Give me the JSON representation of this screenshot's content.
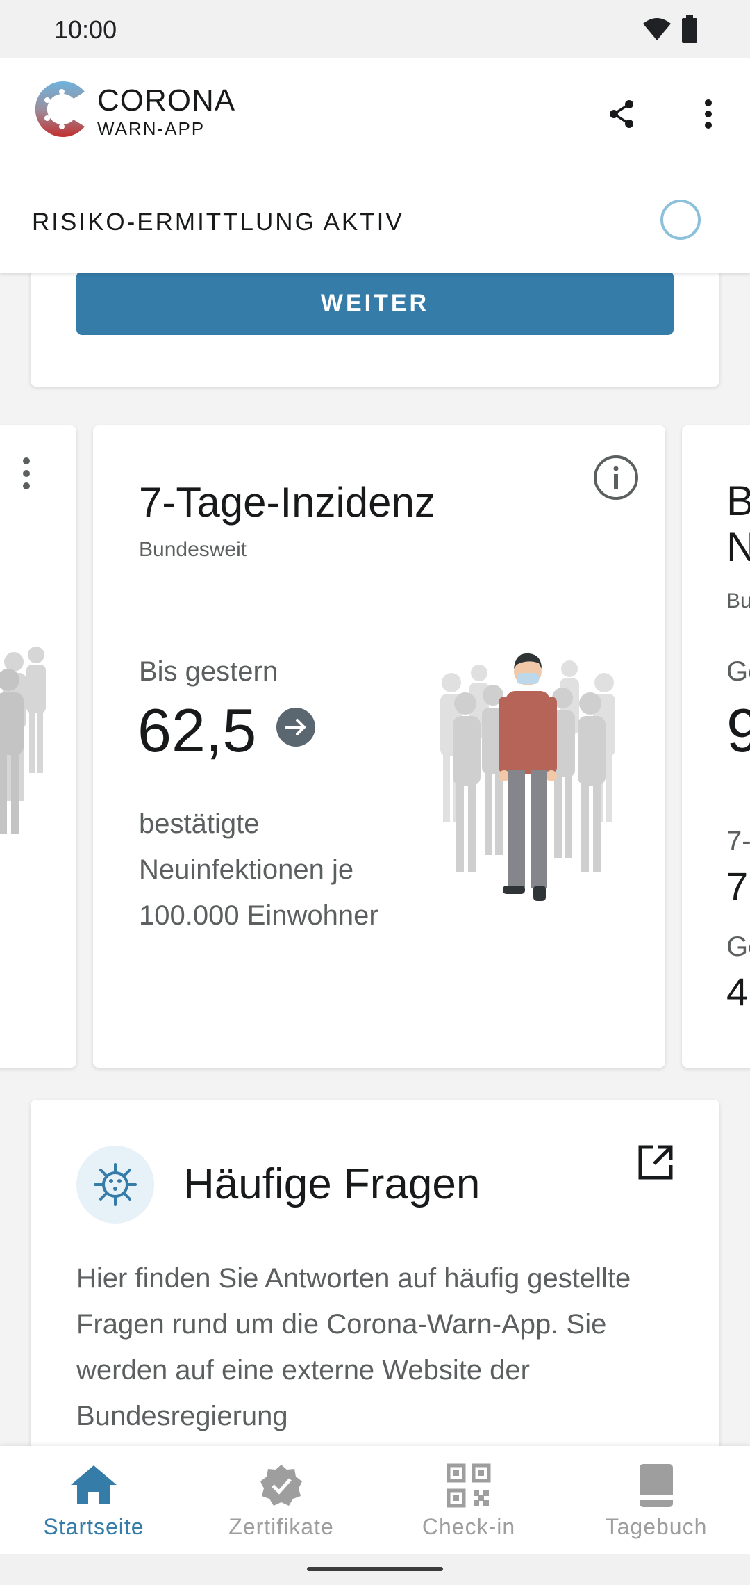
{
  "status_bar": {
    "time": "10:00"
  },
  "app": {
    "logo_title": "CORONA",
    "logo_subtitle": "WARN-APP"
  },
  "risk_bar": {
    "label": "RISIKO-ERMITTLUNG AKTIV"
  },
  "weiter_card": {
    "button_label": "WEITER"
  },
  "incidence_card": {
    "title": "7-Tage-Inzidenz",
    "subtitle": "Bundesweit",
    "period": "Bis gestern",
    "value": "62,5",
    "description": "bestätigte Neuinfektionen je 100.000 Einwohner"
  },
  "next_card_partial": {
    "title_line1": "B",
    "title_line2": "N",
    "subtitle": "Bu",
    "period": "Ge",
    "value": "9",
    "secondary_label": "7-",
    "secondary_value": "7",
    "tertiary_label": "Ge",
    "tertiary_value": "4"
  },
  "faq_card": {
    "title": "Häufige Fragen",
    "text": "Hier finden Sie Antworten auf häufig gestellte Fragen rund um die Corona-Warn-App. Sie werden auf eine externe Website der Bundesregierung"
  },
  "bottom_nav": {
    "items": [
      {
        "label": "Startseite",
        "icon": "home-icon",
        "active": true
      },
      {
        "label": "Zertifikate",
        "icon": "certificate-icon",
        "active": false
      },
      {
        "label": "Check-in",
        "icon": "qr-code-icon",
        "active": false
      },
      {
        "label": "Tagebuch",
        "icon": "book-icon",
        "active": false
      }
    ]
  },
  "colors": {
    "accent": "#357ca9",
    "text_primary": "#17191a",
    "text_secondary": "#5c5f60",
    "inactive": "#9e9e9e",
    "spinner": "#8cc0db",
    "background": "#f3f3f3"
  }
}
